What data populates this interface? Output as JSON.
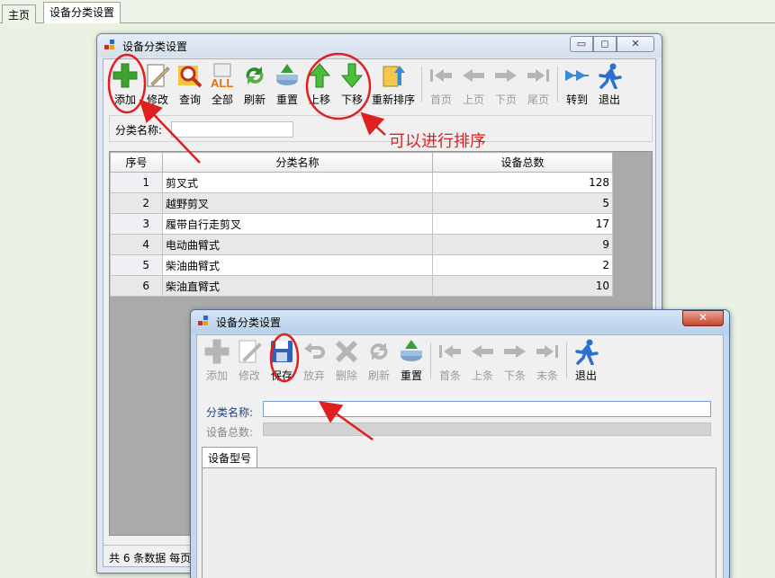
{
  "main_tabs": [
    {
      "label": "主页"
    },
    {
      "label": "设备分类设置"
    }
  ],
  "window1": {
    "title": "设备分类设置",
    "caption_buttons": {
      "minimize": "▭",
      "maximize": "◻",
      "close": "✕"
    },
    "toolbar": [
      {
        "label": "添加",
        "icon": "plus-icon",
        "enabled": true
      },
      {
        "label": "修改",
        "icon": "edit-icon",
        "enabled": true
      },
      {
        "label": "查询",
        "icon": "magnifier-icon",
        "enabled": true
      },
      {
        "label": "全部",
        "icon": "all-icon",
        "enabled": true
      },
      {
        "label": "刷新",
        "icon": "refresh-icon",
        "enabled": true
      },
      {
        "label": "重置",
        "icon": "reset-icon",
        "enabled": true
      },
      {
        "label": "上移",
        "icon": "arrow-up-icon",
        "enabled": true
      },
      {
        "label": "下移",
        "icon": "arrow-down-icon",
        "enabled": true
      },
      {
        "label": "重新排序",
        "icon": "sort-icon",
        "enabled": true
      },
      {
        "label": "首页",
        "icon": "first-page-icon",
        "enabled": false
      },
      {
        "label": "上页",
        "icon": "prev-page-icon",
        "enabled": false
      },
      {
        "label": "下页",
        "icon": "next-page-icon",
        "enabled": false
      },
      {
        "label": "尾页",
        "icon": "last-page-icon",
        "enabled": false
      },
      {
        "label": "转到",
        "icon": "goto-icon",
        "enabled": true
      },
      {
        "label": "退出",
        "icon": "exit-runner-icon",
        "enabled": true
      }
    ],
    "search": {
      "label": "分类名称:",
      "value": ""
    },
    "grid": {
      "headers": [
        "序号",
        "分类名称",
        "设备总数"
      ],
      "rows": [
        [
          "1",
          "剪叉式",
          "128"
        ],
        [
          "2",
          "越野剪叉",
          "5"
        ],
        [
          "3",
          "履带自行走剪叉",
          "17"
        ],
        [
          "4",
          "电动曲臂式",
          "9"
        ],
        [
          "5",
          "柴油曲臂式",
          "2"
        ],
        [
          "6",
          "柴油直臂式",
          "10"
        ]
      ]
    },
    "status": "共 6 条数据 每页"
  },
  "window2": {
    "title": "设备分类设置",
    "close_symbol": "✕",
    "toolbar": [
      {
        "label": "添加",
        "icon": "plus-icon",
        "enabled": false
      },
      {
        "label": "修改",
        "icon": "edit-icon",
        "enabled": false
      },
      {
        "label": "保存",
        "icon": "floppy-disk-icon",
        "enabled": true
      },
      {
        "label": "放弃",
        "icon": "undo-icon",
        "enabled": false
      },
      {
        "label": "删除",
        "icon": "delete-icon",
        "enabled": false
      },
      {
        "label": "刷新",
        "icon": "refresh-icon",
        "enabled": false
      },
      {
        "label": "重置",
        "icon": "reset-icon",
        "enabled": true
      },
      {
        "label": "首条",
        "icon": "first-record-icon",
        "enabled": false
      },
      {
        "label": "上条",
        "icon": "prev-record-icon",
        "enabled": false
      },
      {
        "label": "下条",
        "icon": "next-record-icon",
        "enabled": false
      },
      {
        "label": "末条",
        "icon": "last-record-icon",
        "enabled": false
      },
      {
        "label": "退出",
        "icon": "exit-runner-icon",
        "enabled": true
      }
    ],
    "fields": {
      "category_name_label": "分类名称:",
      "category_name_value": "",
      "device_total_label": "设备总数:"
    },
    "tab": "设备型号"
  },
  "annotation": {
    "text": "可以进行排序",
    "color": "#e02020"
  }
}
